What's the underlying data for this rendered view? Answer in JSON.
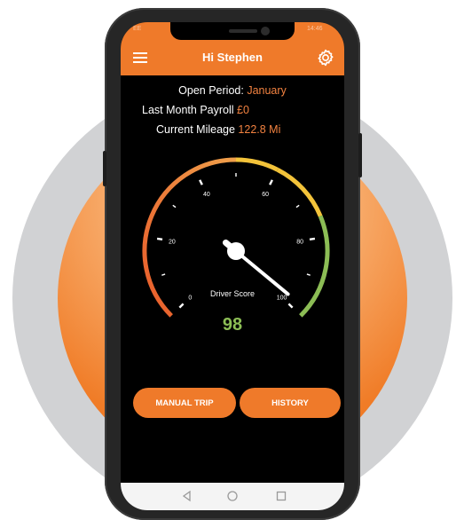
{
  "app": {
    "title": "Hi Stephen",
    "status_time": "14:46",
    "status_left": "EE"
  },
  "info": {
    "open_period_label": "Open Period:",
    "open_period_value": "January",
    "payroll_label": "Last Month Payroll",
    "payroll_value": "£0",
    "mileage_label": "Current Mileage",
    "mileage_value": "122.8 Mi"
  },
  "gauge": {
    "ticks": [
      "0",
      "20",
      "40",
      "60",
      "80",
      "100"
    ],
    "label": "Driver Score",
    "score": "98",
    "max": 100,
    "colors": {
      "red": "#e85b2a",
      "orange": "#f0a04b",
      "yellow": "#f3c33a",
      "green": "#8cbd55"
    }
  },
  "buttons": {
    "manual": "MANUAL TRIP",
    "history": "HISTORY"
  },
  "icons": {
    "menu": "menu-icon",
    "settings": "gear-icon",
    "back": "back-icon",
    "home": "home-icon",
    "recent": "recent-apps-icon"
  },
  "colors": {
    "accent": "#ef7a2a",
    "background": "#000000"
  }
}
